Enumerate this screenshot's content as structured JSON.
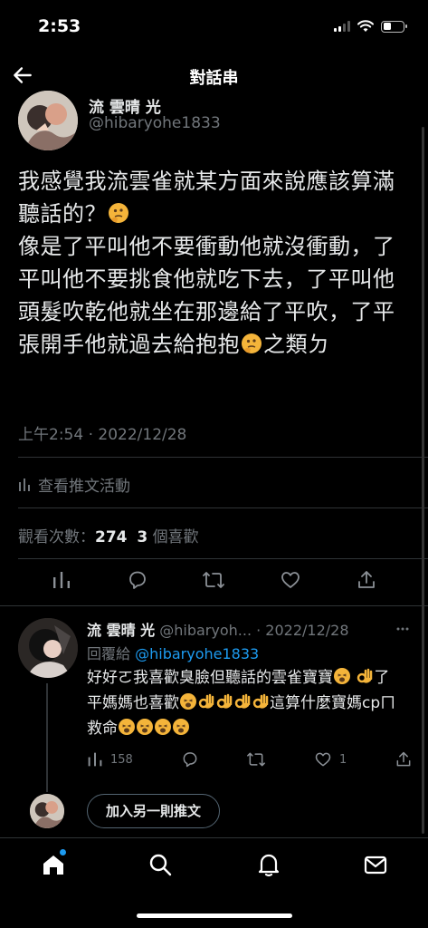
{
  "status": {
    "time": "2:53"
  },
  "header": {
    "title": "對話串"
  },
  "main_tweet": {
    "author_name": "流 雲晴 光",
    "author_handle": "@hibaryohe1833",
    "text_line1": "我感覺我流雲雀就某方面來說應該算滿聽話的？",
    "text_line2": "像是了平叫他不要衝動他就沒衝動，了平叫他不要挑食他就吃下去，了平叫他頭髮吹乾他就坐在那邊給了平吹，了平張開手他就過去給抱抱",
    "text_line2_end": "之類ㄉ",
    "timestamp": "上午2:54 · 2022/12/28",
    "activity_label": "查看推文活動",
    "views_label": "觀看次數：",
    "views_count": "274",
    "likes_count": "3",
    "likes_label": "個喜歡"
  },
  "reply": {
    "author_name": "流 雲晴 光",
    "author_handle_short": "@hibaryoh...",
    "date": "· 2022/12/28",
    "reply_to_label": "回覆給",
    "reply_to_handle": "@hibaryohe1833",
    "text_part1": "好好ㄛ我喜歡臭臉但聽話的雲雀寶寶",
    "text_part2": "了平媽媽也喜歡",
    "text_part3": "這算什麼寶媽cpㄇ救命",
    "views_count": "158",
    "likes_count": "1"
  },
  "add_reply": {
    "button_label": "加入另一則推文"
  },
  "icons": {
    "thinking": "thinking-face-icon",
    "ok_hand": "ok-hand-icon",
    "weary": "weary-face-icon"
  },
  "colors": {
    "accent": "#1d9bf0",
    "muted": "#71767b",
    "background": "#000000"
  }
}
